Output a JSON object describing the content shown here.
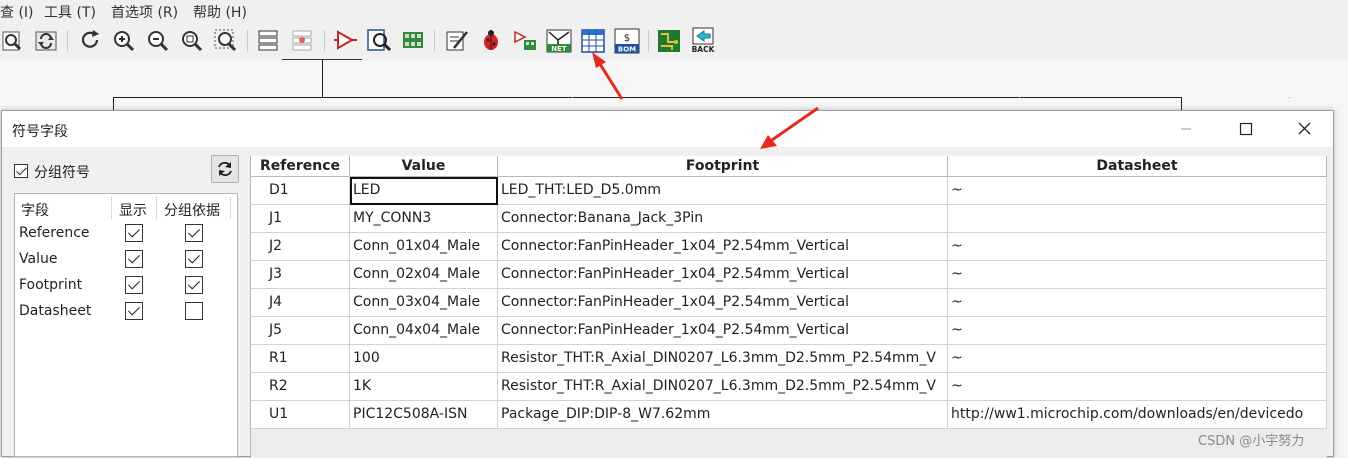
{
  "menu": {
    "view": "查 (I)",
    "tools": "工具 (T)",
    "prefs": "首选项 (R)",
    "help": "帮助 (H)"
  },
  "toolbar": {
    "icons": [
      "zoom-page-icon",
      "redraw-icon",
      "rotate-icon",
      "zoom-in-icon",
      "zoom-out-icon",
      "zoom-fit-icon",
      "zoom-selection-icon",
      "hierarchy-navigator-icon",
      "leave-sheet-icon",
      "symbol-editor-icon",
      "symbol-browser-icon",
      "footprint-editor-icon",
      "annotate-icon",
      "erc-icon",
      "assign-footprints-icon",
      "netlist-icon",
      "symbol-fields-table-icon",
      "bom-icon",
      "pcb-editor-icon",
      "back-annotate-icon"
    ],
    "netlist_badge": "NET",
    "bom_badge": "BOM",
    "back_badge": "BACK"
  },
  "colors": {
    "arrow": "#e8281f",
    "grid_line": "#d2d2d2",
    "accent": "#2c6fd1"
  },
  "dialog": {
    "title": "符号字段",
    "group_symbols": {
      "label": "分组符号",
      "checked": true
    },
    "fields_panel": {
      "headers": {
        "field": "字段",
        "show": "显示",
        "group_by": "分组依据"
      },
      "rows": [
        {
          "name": "Reference",
          "show": true,
          "group": true
        },
        {
          "name": "Value",
          "show": true,
          "group": true
        },
        {
          "name": "Footprint",
          "show": true,
          "group": true
        },
        {
          "name": "Datasheet",
          "show": true,
          "group": false
        }
      ]
    },
    "grid": {
      "columns": [
        "Reference",
        "Value",
        "Footprint",
        "Datasheet"
      ],
      "rows": [
        {
          "ref": "D1",
          "value": "LED",
          "footprint": "LED_THT:LED_D5.0mm",
          "datasheet": "~"
        },
        {
          "ref": "J1",
          "value": "MY_CONN3",
          "footprint": "Connector:Banana_Jack_3Pin",
          "datasheet": ""
        },
        {
          "ref": "J2",
          "value": "Conn_01x04_Male",
          "footprint": "Connector:FanPinHeader_1x04_P2.54mm_Vertical",
          "datasheet": "~"
        },
        {
          "ref": "J3",
          "value": "Conn_02x04_Male",
          "footprint": "Connector:FanPinHeader_1x04_P2.54mm_Vertical",
          "datasheet": "~"
        },
        {
          "ref": "J4",
          "value": "Conn_03x04_Male",
          "footprint": "Connector:FanPinHeader_1x04_P2.54mm_Vertical",
          "datasheet": "~"
        },
        {
          "ref": "J5",
          "value": "Conn_04x04_Male",
          "footprint": "Connector:FanPinHeader_1x04_P2.54mm_Vertical",
          "datasheet": "~"
        },
        {
          "ref": "R1",
          "value": "100",
          "footprint": "Resistor_THT:R_Axial_DIN0207_L6.3mm_D2.5mm_P2.54mm_V",
          "datasheet": "~"
        },
        {
          "ref": "R2",
          "value": "1K",
          "footprint": "Resistor_THT:R_Axial_DIN0207_L6.3mm_D2.5mm_P2.54mm_V",
          "datasheet": "~"
        },
        {
          "ref": "U1",
          "value": "PIC12C508A-ISN",
          "footprint": "Package_DIP:DIP-8_W7.62mm",
          "datasheet": "http://ww1.microchip.com/downloads/en/devicedo"
        }
      ]
    }
  },
  "watermark": "CSDN @小宇努力"
}
